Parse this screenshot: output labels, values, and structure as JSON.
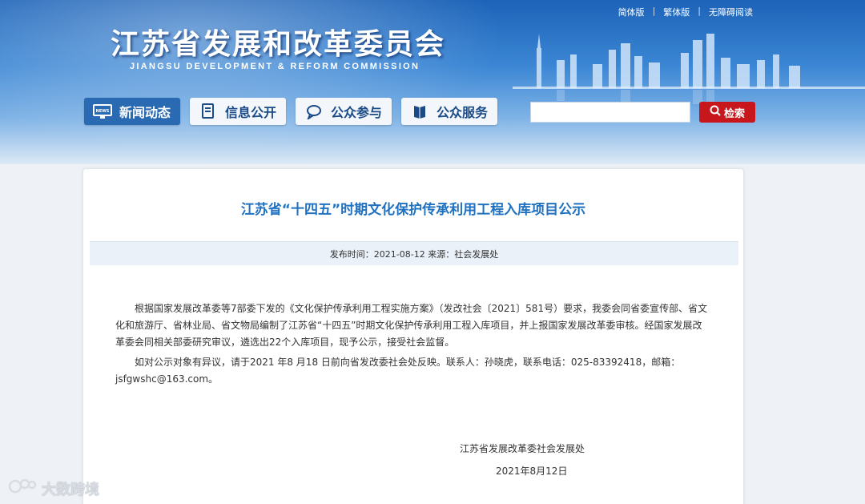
{
  "header": {
    "title_cn": "江苏省发展和改革委员会",
    "title_en": "JIANGSU DEVELOPMENT & REFORM COMMISSION",
    "links": [
      "简体版",
      "繁体版",
      "无障碍阅读"
    ],
    "separator": "|"
  },
  "nav": {
    "items": [
      {
        "label": "新闻动态",
        "icon": "news-icon",
        "active": true
      },
      {
        "label": "信息公开",
        "icon": "document-icon",
        "active": false
      },
      {
        "label": "公众参与",
        "icon": "chat-icon",
        "active": false
      },
      {
        "label": "公众服务",
        "icon": "book-icon",
        "active": false
      }
    ]
  },
  "search": {
    "placeholder": "",
    "button_label": "检索",
    "button_color": "#c8161d"
  },
  "article": {
    "title": "江苏省“十四五”时期文化保护传承利用工程入库项目公示",
    "meta": "发布时间：2021-08-12 来源：社会发展处",
    "paragraphs": [
      "根据国家发展改革委等7部委下发的《文化保护传承利用工程实施方案》（发改社会〔2021〕581号）要求，我委会同省委宣传部、省文化和旅游厅、省林业局、省文物局编制了江苏省“十四五”时期文化保护传承利用工程入库项目，并上报国家发展改革委审核。经国家发展改革委会同相关部委研究审议，遴选出22个入库项目，现予公示，接受社会监督。",
      "如对公示对象有异议，请于2021 年8 月18 日前向省发改委社会处反映。联系人：孙晓虎，联系电话：025-83392418，邮箱：jsfgwshc@163.com。"
    ],
    "signature_org": "江苏省发展改革委社会发展处",
    "signature_date": "2021年8月12日"
  },
  "watermark": {
    "text": "大数跨境"
  },
  "colors": {
    "accent": "#2071c0",
    "nav_active": "#2a6ab3",
    "header": "#1d63b8"
  }
}
